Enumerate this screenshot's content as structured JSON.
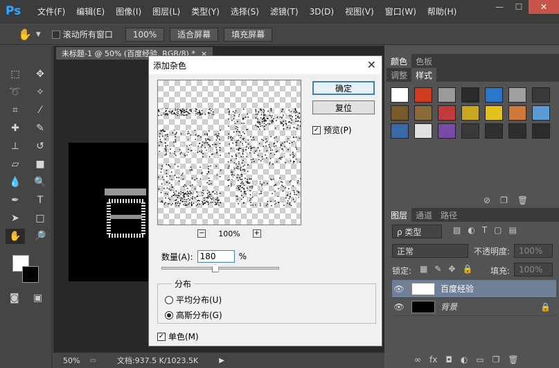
{
  "app": {
    "logo": "Ps"
  },
  "menu": [
    "文件(F)",
    "编辑(E)",
    "图像(I)",
    "图层(L)",
    "类型(Y)",
    "选择(S)",
    "滤镜(T)",
    "3D(D)",
    "视图(V)",
    "窗口(W)",
    "帮助(H)"
  ],
  "window_controls": {
    "minimize": "—",
    "maximize": "☐",
    "close": "✕"
  },
  "options": {
    "scroll_all_label": "滚动所有窗口",
    "zoom_100": "100%",
    "fit_screen": "适合屏幕",
    "fill_screen": "填充屏幕"
  },
  "document": {
    "tab_title": "未标题-1 @ 50% (百度经验, RGB/8) *",
    "tab_close": "×"
  },
  "status": {
    "zoom": "50%",
    "doc_info": "文档:937.5 K/1023.5K"
  },
  "panels": {
    "top_tabs": [
      "颜色",
      "色板"
    ],
    "second_tabs": [
      "调整",
      "样式"
    ],
    "layer_tabs": [
      "图层",
      "通道",
      "路径"
    ],
    "filter_kind": "ρ 类型",
    "blend_mode": "正常",
    "opacity_label": "不透明度:",
    "opacity_value": "100%",
    "lock_label": "锁定:",
    "fill_label": "填充:",
    "fill_value": "100%",
    "layers": [
      {
        "name": "百度经验",
        "selected": true
      },
      {
        "name": "背景",
        "selected": false
      }
    ]
  },
  "swatch_colors": [
    "#ffffff",
    "#d03b1e",
    "#9a9a9a",
    "#2a2a2a",
    "#2a76c9",
    "#a0a0a0",
    "#3a3a3a",
    "#7a5a2a",
    "#8a6a3a",
    "#c23a3a",
    "#c9a81f",
    "#e3c21c",
    "#d07a3a",
    "#5a9ad6",
    "#3a6aa6",
    "#e0e0e0",
    "#7a4aa6",
    "#3a3a3a",
    "#303030",
    "#2e2e2e",
    "#2c2c2c"
  ],
  "dialog": {
    "title": "添加杂色",
    "close": "✕",
    "ok": "确定",
    "reset": "复位",
    "preview_label": "预览(P)",
    "zoom_minus": "−",
    "zoom_value": "100%",
    "zoom_plus": "+",
    "amount_label": "数量(A):",
    "amount_value": "180",
    "amount_unit": "%",
    "amount_slider_fraction": 0.45,
    "distribution_label": "分布",
    "uniform_label": "平均分布(U)",
    "gaussian_label": "高斯分布(G)",
    "selected_distribution": "gaussian",
    "mono_label": "单色(M)",
    "preview_checked": true,
    "mono_checked": true
  }
}
